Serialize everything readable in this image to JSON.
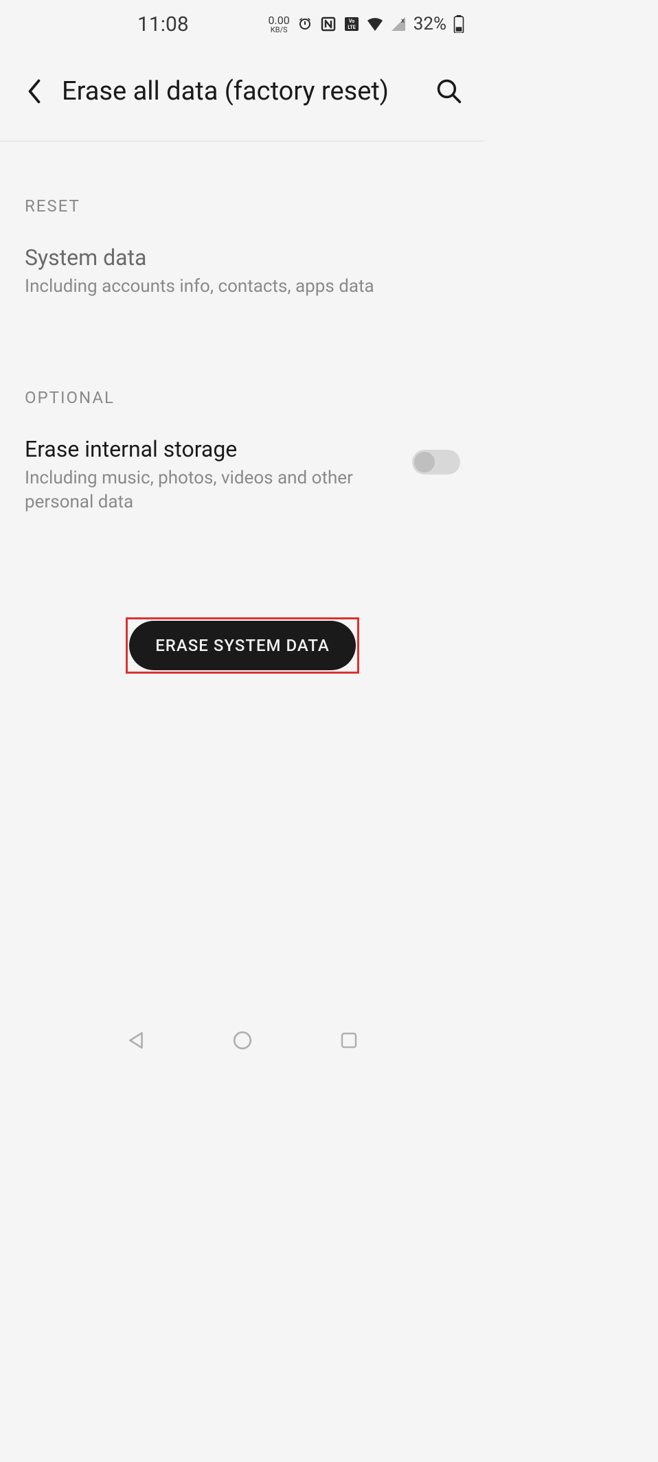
{
  "status": {
    "time": "11:08",
    "net_speed_value": "0.00",
    "net_speed_unit": "KB/S",
    "battery_pct": "32%"
  },
  "header": {
    "title": "Erase all data (factory reset)"
  },
  "sections": {
    "reset": {
      "header": "RESET",
      "item": {
        "title": "System data",
        "desc": "Including accounts info, contacts, apps data"
      }
    },
    "optional": {
      "header": "OPTIONAL",
      "item": {
        "title": "Erase internal storage",
        "desc": "Including music, photos, videos and other personal data",
        "toggle_on": false
      }
    }
  },
  "action": {
    "label": "ERASE SYSTEM DATA"
  }
}
